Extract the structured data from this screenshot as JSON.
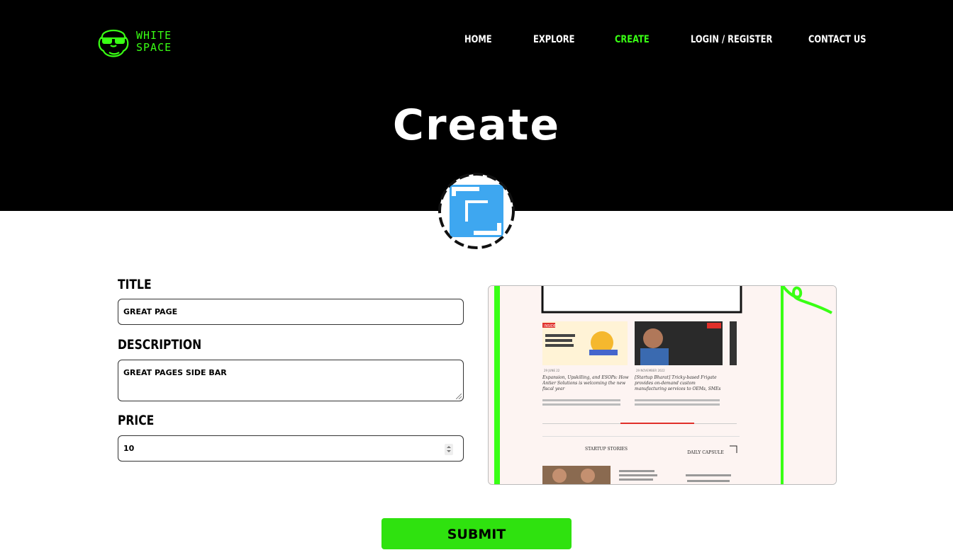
{
  "brand": {
    "line1": "WHITE",
    "line2": "SPACE",
    "accent": "#39ff14"
  },
  "nav": {
    "home": "HOME",
    "explore": "EXPLORE",
    "create": "CREATE",
    "login": "LOGIN / REGISTER",
    "contact": "CONTACT US"
  },
  "page": {
    "title": "Create",
    "icon": "app-logo-icon"
  },
  "form": {
    "title_label": "TITLE",
    "title_value": "GREAT PAGE",
    "description_label": "DESCRIPTION",
    "description_value": "GREAT PAGES SIDE BAR",
    "price_label": "PRICE",
    "price_value": "10",
    "submit_label": "SUBMIT"
  },
  "preview": {
    "card1_tag": "INSIDE",
    "card1_date": "29 JUNE 22",
    "card1_headline": "Expansion, Upskilling, and ESOPs: How Antier Solutions is welcoming the new fiscal year",
    "card2_date": "29 NOVEMBER 2022",
    "card2_headline": "[Startup Bharat] Tricky-based Frigate provides on-demand custom manufacturing services to OEMs, SMEs",
    "section1": "STARTUP STORIES",
    "section2": "DAILY CAPSULE"
  },
  "colors": {
    "hero_bg": "#000000",
    "accent": "#39ff14",
    "submit_bg": "#2fe20f",
    "icon_blue": "#3ea7f0"
  }
}
